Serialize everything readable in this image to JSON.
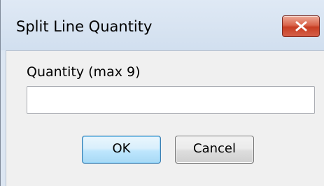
{
  "window": {
    "title": "Split Line Quantity"
  },
  "form": {
    "label": "Quantity (max 9)",
    "value": "",
    "placeholder": ""
  },
  "buttons": {
    "ok_label": "OK",
    "cancel_label": "Cancel"
  },
  "icons": {
    "close": "close-icon"
  },
  "colors": {
    "titlebar": "#d7e3f1",
    "close_button": "#c73e23",
    "dialog_background": "#f0f0f0",
    "ok_button": "#bee6fd",
    "ok_border": "#3c7fb1"
  }
}
